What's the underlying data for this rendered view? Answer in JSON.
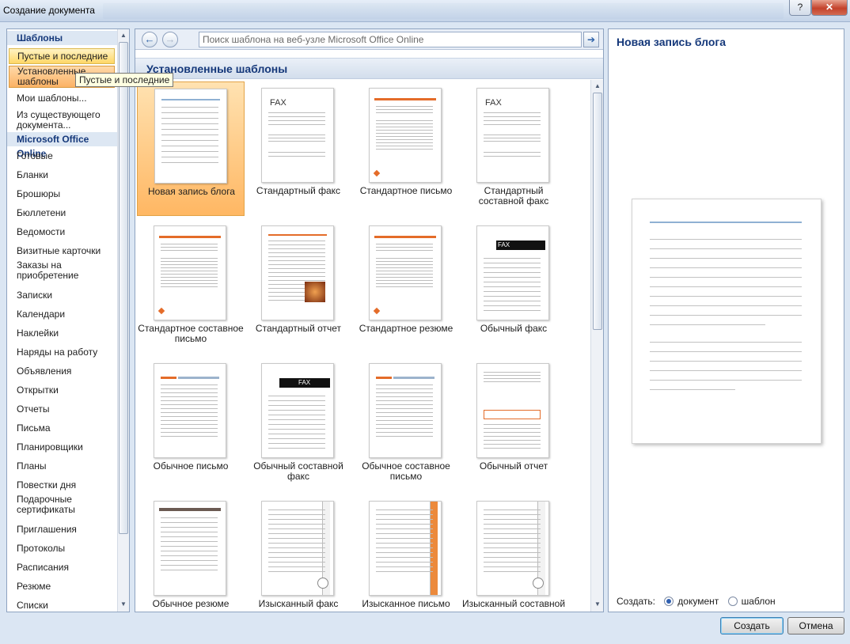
{
  "window": {
    "title": "Создание документа",
    "help": "?",
    "close": "✕"
  },
  "left": {
    "header_templates": "Шаблоны",
    "items": [
      {
        "label": "Пустые и последние"
      },
      {
        "label": "Установленные\nшаблоны"
      },
      {
        "label": "Мои шаблоны..."
      },
      {
        "label": "Из существующего\nдокумента..."
      }
    ],
    "header_online": "Microsoft Office Online",
    "online_items": [
      {
        "label": "Готовые"
      },
      {
        "label": "Бланки"
      },
      {
        "label": "Брошюры"
      },
      {
        "label": "Бюллетени"
      },
      {
        "label": "Ведомости"
      },
      {
        "label": "Визитные карточки"
      },
      {
        "label": "Заказы на\nприобретение"
      },
      {
        "label": "Записки"
      },
      {
        "label": "Календари"
      },
      {
        "label": "Наклейки"
      },
      {
        "label": "Наряды на работу"
      },
      {
        "label": "Объявления"
      },
      {
        "label": "Открытки"
      },
      {
        "label": "Отчеты"
      },
      {
        "label": "Письма"
      },
      {
        "label": "Планировщики"
      },
      {
        "label": "Планы"
      },
      {
        "label": "Повестки дня"
      },
      {
        "label": "Подарочные\nсертификаты"
      },
      {
        "label": "Приглашения"
      },
      {
        "label": "Протоколы"
      },
      {
        "label": "Расписания"
      },
      {
        "label": "Резюме"
      },
      {
        "label": "Списки"
      }
    ],
    "tooltip": "Пустые и последние"
  },
  "center": {
    "search_placeholder": "Поиск шаблона на веб-узле Microsoft Office Online",
    "section_title": "Установленные шаблоны",
    "templates": [
      {
        "label": "Новая запись блога",
        "kind": "blog"
      },
      {
        "label": "Стандартный факс",
        "kind": "fax-std"
      },
      {
        "label": "Стандартное письмо",
        "kind": "letter-std"
      },
      {
        "label": "Стандартный\nсоставной факс",
        "kind": "fax-std"
      },
      {
        "label": "Стандартное составное\nписьмо",
        "kind": "letter-std"
      },
      {
        "label": "Стандартный отчет",
        "kind": "report-std"
      },
      {
        "label": "Стандартное резюме",
        "kind": "letter-std"
      },
      {
        "label": "Обычный факс",
        "kind": "fax-black"
      },
      {
        "label": "Обычное письмо",
        "kind": "letter-plain"
      },
      {
        "label": "Обычный составной\nфакс",
        "kind": "fax-black2"
      },
      {
        "label": "Обычное составное\nписьмо",
        "kind": "letter-plain"
      },
      {
        "label": "Обычный отчет",
        "kind": "report-plain"
      },
      {
        "label": "Обычное резюме",
        "kind": "resume-plain"
      },
      {
        "label": "Изысканный факс",
        "kind": "fancy"
      },
      {
        "label": "Изысканное письмо",
        "kind": "fancy-orange"
      },
      {
        "label": "Изысканный составной",
        "kind": "fancy"
      }
    ]
  },
  "right": {
    "preview_title": "Новая запись блога",
    "create_label": "Создать:",
    "option_document": "документ",
    "option_template": "шаблон"
  },
  "buttons": {
    "create": "Создать",
    "cancel": "Отмена"
  }
}
